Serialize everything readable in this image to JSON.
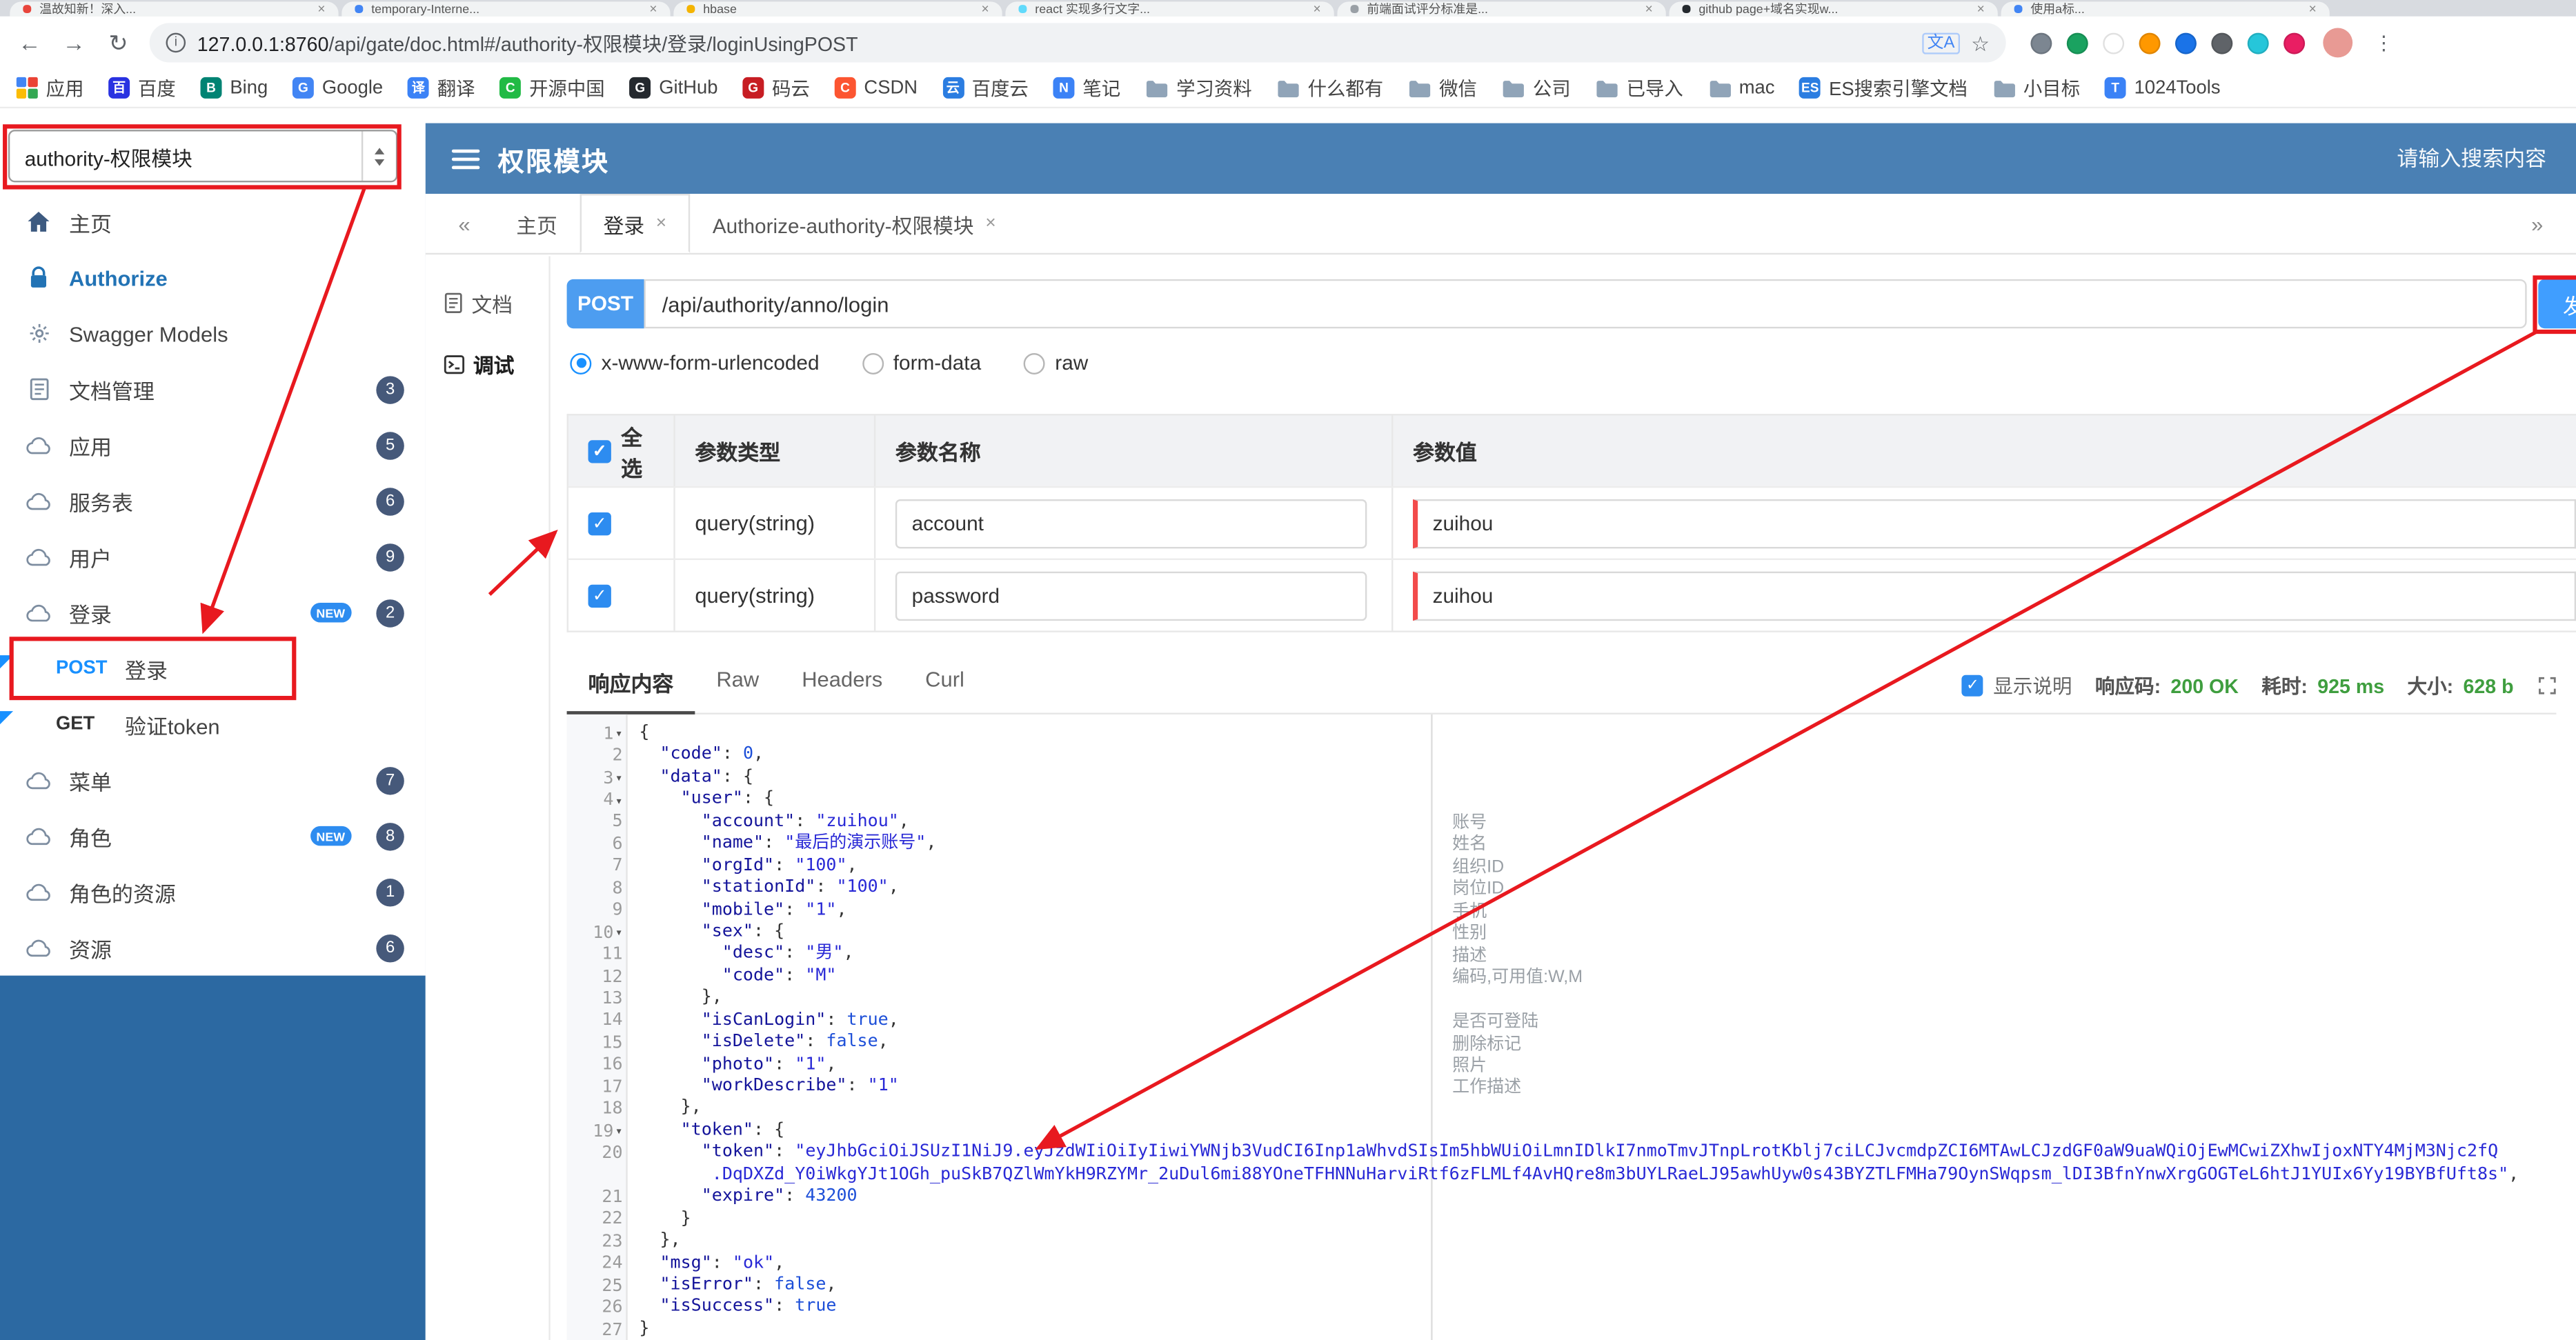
{
  "glyphs": {
    "check": "✓",
    "close": "×",
    "chevron_left": "«",
    "chevron_right": "»",
    "back": "←",
    "forward": "→",
    "reload": "↻",
    "star": "☆",
    "dots": "⋮",
    "fold": "▾",
    "info": "i",
    "translate": "文A"
  },
  "browser": {
    "tab_strip": [
      {
        "title": "温故知新！深入...",
        "favicon": "#e8453c"
      },
      {
        "title": "temporary-Interne...",
        "favicon": "#4285f4"
      },
      {
        "title": "hbase",
        "favicon": "#f4b400"
      },
      {
        "title": "react 实现多行文字...",
        "favicon": "#61dafb"
      },
      {
        "title": "前端面试评分标准是...",
        "favicon": "#9aa0a6"
      },
      {
        "title": "github page+域名实现w...",
        "favicon": "#24292e"
      },
      {
        "title": "使用a标...",
        "favicon": "#4285f4"
      }
    ],
    "address": {
      "url_host": "127.0.0.1:8760",
      "url_path": "/api/gate/doc.html#/authority-权限模块/登录/loginUsingPOST"
    },
    "extensions": [
      {
        "color": "#7c8691"
      },
      {
        "color": "#1aa260"
      },
      {
        "color": "#ffffff"
      },
      {
        "color": "#ff9800"
      },
      {
        "color": "#1a73e8"
      },
      {
        "color": "#5f6368"
      },
      {
        "color": "#26c6da"
      },
      {
        "color": "#e91e63"
      }
    ],
    "bookmarks": [
      {
        "label": "应用",
        "icon": "apps"
      },
      {
        "label": "百度",
        "icon": "letter",
        "letter": "百",
        "color": "#2932e1"
      },
      {
        "label": "Bing",
        "icon": "letter",
        "letter": "B",
        "color": "#008373"
      },
      {
        "label": "Google",
        "icon": "letter",
        "letter": "G",
        "color": "#4285f4"
      },
      {
        "label": "翻译",
        "icon": "letter",
        "letter": "译",
        "color": "#3b82f6"
      },
      {
        "label": "开源中国",
        "icon": "letter",
        "letter": "C",
        "color": "#21ba45"
      },
      {
        "label": "GitHub",
        "icon": "letter",
        "letter": "G",
        "color": "#24292e"
      },
      {
        "label": "码云",
        "icon": "letter",
        "letter": "G",
        "color": "#c71d23"
      },
      {
        "label": "CSDN",
        "icon": "letter",
        "letter": "C",
        "color": "#fc5531"
      },
      {
        "label": "百度云",
        "icon": "letter",
        "letter": "云",
        "color": "#2b7de1"
      },
      {
        "label": "笔记",
        "icon": "letter",
        "letter": "N",
        "color": "#3b82f6"
      },
      {
        "label": "学习资料",
        "icon": "folder"
      },
      {
        "label": "什么都有",
        "icon": "folder"
      },
      {
        "label": "微信",
        "icon": "folder"
      },
      {
        "label": "公司",
        "icon": "folder"
      },
      {
        "label": "已导入",
        "icon": "folder"
      },
      {
        "label": "mac",
        "icon": "folder"
      },
      {
        "label": "ES搜索引擎文档",
        "icon": "letter",
        "letter": "ES",
        "color": "#2b7de1"
      },
      {
        "label": "小目标",
        "icon": "folder"
      },
      {
        "label": "1024Tools",
        "icon": "letter",
        "letter": "T",
        "color": "#3b82f6"
      }
    ]
  },
  "app_header": {
    "module_selector_value": "authority-权限模块",
    "title": "权限模块",
    "search_placeholder": "请输入搜索内容"
  },
  "sidebar": {
    "new_badge_label": "NEW",
    "items": [
      {
        "icon": "home",
        "label": "主页"
      },
      {
        "icon": "lock",
        "label": "Authorize",
        "style": "authorize"
      },
      {
        "icon": "models",
        "label": "Swagger Models"
      },
      {
        "icon": "docs",
        "label": "文档管理",
        "badge": "3"
      },
      {
        "icon": "cloud",
        "label": "应用",
        "badge": "5"
      },
      {
        "icon": "cloud",
        "label": "服务表",
        "badge": "6"
      },
      {
        "icon": "cloud",
        "label": "用户",
        "badge": "9"
      },
      {
        "icon": "cloud",
        "label": "登录",
        "badge": "2",
        "new": true
      },
      {
        "api": true,
        "method": "POST",
        "label": "登录",
        "flagged": true,
        "highlight_box": true
      },
      {
        "api": true,
        "method": "GET",
        "label": "验证token",
        "flagged": true
      },
      {
        "icon": "cloud",
        "label": "菜单",
        "badge": "7"
      },
      {
        "icon": "cloud",
        "label": "角色",
        "badge": "8",
        "new": true
      },
      {
        "icon": "cloud",
        "label": "角色的资源",
        "badge": "1"
      },
      {
        "icon": "cloud",
        "label": "资源",
        "badge": "6"
      }
    ]
  },
  "content_tabs": {
    "tabs": [
      {
        "label": "主页",
        "closable": false,
        "active": false
      },
      {
        "label": "登录",
        "closable": true,
        "active": true
      },
      {
        "label": "Authorize-authority-权限模块",
        "closable": true,
        "active": false
      }
    ]
  },
  "doc_nav": {
    "items": [
      {
        "icon": "doc",
        "label": "文档",
        "active": false
      },
      {
        "icon": "debug",
        "label": "调试",
        "active": true
      }
    ]
  },
  "request": {
    "method": "POST",
    "path": "/api/authority/anno/login",
    "send_button": "发送",
    "content_types": [
      {
        "label": "x-www-form-urlencoded",
        "selected": true
      },
      {
        "label": "form-data",
        "selected": false
      },
      {
        "label": "raw",
        "selected": false
      }
    ],
    "params_table": {
      "headers": [
        "全选",
        "参数类型",
        "参数名称",
        "参数值"
      ],
      "rows": [
        {
          "checked": true,
          "type": "query(string)",
          "name": "account",
          "value": "zuihou"
        },
        {
          "checked": true,
          "type": "query(string)",
          "name": "password",
          "value": "zuihou"
        }
      ]
    }
  },
  "response": {
    "tabs": [
      {
        "label": "响应内容",
        "active": true
      },
      {
        "label": "Raw",
        "active": false
      },
      {
        "label": "Headers",
        "active": false
      },
      {
        "label": "Curl",
        "active": false
      }
    ],
    "show_description_label": "显示说明",
    "show_description_checked": true,
    "status_code_label": "响应码:",
    "status_code": "200 OK",
    "elapsed_label": "耗时:",
    "elapsed": "925 ms",
    "size_label": "大小:",
    "size": "628 b",
    "field_descriptions": [
      {
        "row": 5,
        "label": "账号"
      },
      {
        "row": 6,
        "label": "姓名"
      },
      {
        "row": 7,
        "label": "组织ID"
      },
      {
        "row": 8,
        "label": "岗位ID"
      },
      {
        "row": 9,
        "label": "手机"
      },
      {
        "row": 10,
        "label": "性别"
      },
      {
        "row": 11,
        "label": "描述"
      },
      {
        "row": 12,
        "label": "编码,可用值:W,M"
      },
      {
        "row": 14,
        "label": "是否可登陆"
      },
      {
        "row": 15,
        "label": "删除标记"
      },
      {
        "row": 16,
        "label": "照片"
      },
      {
        "row": 17,
        "label": "工作描述"
      }
    ],
    "code_lines": [
      {
        "n": "1",
        "fold": true,
        "seg": [
          [
            "p",
            "{"
          ]
        ]
      },
      {
        "n": "2",
        "seg": [
          [
            "w",
            "  "
          ],
          [
            "k",
            "\"code\""
          ],
          [
            "p",
            ": "
          ],
          [
            "v",
            "0"
          ],
          [
            "p",
            ","
          ]
        ]
      },
      {
        "n": "3",
        "fold": true,
        "seg": [
          [
            "w",
            "  "
          ],
          [
            "k",
            "\"data\""
          ],
          [
            "p",
            ": {"
          ]
        ]
      },
      {
        "n": "4",
        "fold": true,
        "seg": [
          [
            "w",
            "    "
          ],
          [
            "k",
            "\"user\""
          ],
          [
            "p",
            ": {"
          ]
        ]
      },
      {
        "n": "5",
        "seg": [
          [
            "w",
            "      "
          ],
          [
            "k",
            "\"account\""
          ],
          [
            "p",
            ": "
          ],
          [
            "s",
            "\"zuihou\""
          ],
          [
            "p",
            ","
          ]
        ]
      },
      {
        "n": "6",
        "seg": [
          [
            "w",
            "      "
          ],
          [
            "k",
            "\"name\""
          ],
          [
            "p",
            ": "
          ],
          [
            "s",
            "\"最后的演示账号\""
          ],
          [
            "p",
            ","
          ]
        ]
      },
      {
        "n": "7",
        "seg": [
          [
            "w",
            "      "
          ],
          [
            "k",
            "\"orgId\""
          ],
          [
            "p",
            ": "
          ],
          [
            "s",
            "\"100\""
          ],
          [
            "p",
            ","
          ]
        ]
      },
      {
        "n": "8",
        "seg": [
          [
            "w",
            "      "
          ],
          [
            "k",
            "\"stationId\""
          ],
          [
            "p",
            ": "
          ],
          [
            "s",
            "\"100\""
          ],
          [
            "p",
            ","
          ]
        ]
      },
      {
        "n": "9",
        "seg": [
          [
            "w",
            "      "
          ],
          [
            "k",
            "\"mobile\""
          ],
          [
            "p",
            ": "
          ],
          [
            "s",
            "\"1\""
          ],
          [
            "p",
            ","
          ]
        ]
      },
      {
        "n": "10",
        "fold": true,
        "seg": [
          [
            "w",
            "      "
          ],
          [
            "k",
            "\"sex\""
          ],
          [
            "p",
            ": {"
          ]
        ]
      },
      {
        "n": "11",
        "seg": [
          [
            "w",
            "        "
          ],
          [
            "k",
            "\"desc\""
          ],
          [
            "p",
            ": "
          ],
          [
            "s",
            "\"男\""
          ],
          [
            "p",
            ","
          ]
        ]
      },
      {
        "n": "12",
        "seg": [
          [
            "w",
            "        "
          ],
          [
            "k",
            "\"code\""
          ],
          [
            "p",
            ": "
          ],
          [
            "s",
            "\"M\""
          ]
        ]
      },
      {
        "n": "13",
        "seg": [
          [
            "w",
            "      "
          ],
          [
            "p",
            "},"
          ]
        ]
      },
      {
        "n": "14",
        "seg": [
          [
            "w",
            "      "
          ],
          [
            "k",
            "\"isCanLogin\""
          ],
          [
            "p",
            ": "
          ],
          [
            "v",
            "true"
          ],
          [
            "p",
            ","
          ]
        ]
      },
      {
        "n": "15",
        "seg": [
          [
            "w",
            "      "
          ],
          [
            "k",
            "\"isDelete\""
          ],
          [
            "p",
            ": "
          ],
          [
            "v",
            "false"
          ],
          [
            "p",
            ","
          ]
        ]
      },
      {
        "n": "16",
        "seg": [
          [
            "w",
            "      "
          ],
          [
            "k",
            "\"photo\""
          ],
          [
            "p",
            ": "
          ],
          [
            "s",
            "\"1\""
          ],
          [
            "p",
            ","
          ]
        ]
      },
      {
        "n": "17",
        "seg": [
          [
            "w",
            "      "
          ],
          [
            "k",
            "\"workDescribe\""
          ],
          [
            "p",
            ": "
          ],
          [
            "s",
            "\"1\""
          ]
        ]
      },
      {
        "n": "18",
        "seg": [
          [
            "w",
            "    "
          ],
          [
            "p",
            "},"
          ]
        ]
      },
      {
        "n": "19",
        "fold": true,
        "seg": [
          [
            "w",
            "    "
          ],
          [
            "k",
            "\"token\""
          ],
          [
            "p",
            ": {"
          ]
        ]
      },
      {
        "n": "20",
        "seg": [
          [
            "w",
            "      "
          ],
          [
            "k",
            "\"token\""
          ],
          [
            "p",
            ": "
          ],
          [
            "s",
            "\"eyJhbGciOiJSUzI1NiJ9.eyJzdWIiOiIyIiwiYWNjb3VudCI6Inp1aWhvdSIsIm5hbWUiOiLmnIDlkI7nmoTmvJTnpLrotKblj7ciLCJvcmdpZCI6MTAwLCJzdGF0aW9uaWQiOjEwMCwiZXhwIjoxNTY4MjM3Njc2fQ"
          ]
        ]
      },
      {
        "n": "",
        "seg": [
          [
            "w",
            "       "
          ],
          [
            "s",
            ".DqDXZd_Y0iWkgYJt1OGh_puSkB7QZlWmYkH9RZYMr_2uDul6mi88YOneTFHNNuHarviRtf6zFLMLf4AvHQre8m3bUYLRaeLJ95awhUyw0s43BYZTLFMHa79OynSWqpsm_lDI3BfnYnwXrgGOGTeL6htJ1YUIx6Yy19BYBfUft8s\""
          ],
          [
            "p",
            ","
          ]
        ]
      },
      {
        "n": "21",
        "seg": [
          [
            "w",
            "      "
          ],
          [
            "k",
            "\"expire\""
          ],
          [
            "p",
            ": "
          ],
          [
            "v",
            "43200"
          ]
        ]
      },
      {
        "n": "22",
        "seg": [
          [
            "w",
            "    "
          ],
          [
            "p",
            "}"
          ]
        ]
      },
      {
        "n": "23",
        "seg": [
          [
            "w",
            "  "
          ],
          [
            "p",
            "},"
          ]
        ]
      },
      {
        "n": "24",
        "seg": [
          [
            "w",
            "  "
          ],
          [
            "k",
            "\"msg\""
          ],
          [
            "p",
            ": "
          ],
          [
            "s",
            "\"ok\""
          ],
          [
            "p",
            ","
          ]
        ]
      },
      {
        "n": "25",
        "seg": [
          [
            "w",
            "  "
          ],
          [
            "k",
            "\"isError\""
          ],
          [
            "p",
            ": "
          ],
          [
            "v",
            "false"
          ],
          [
            "p",
            ","
          ]
        ]
      },
      {
        "n": "26",
        "seg": [
          [
            "w",
            "  "
          ],
          [
            "k",
            "\"isSuccess\""
          ],
          [
            "p",
            ": "
          ],
          [
            "v",
            "true"
          ]
        ]
      },
      {
        "n": "27",
        "seg": [
          [
            "p",
            "}"
          ]
        ]
      }
    ]
  }
}
